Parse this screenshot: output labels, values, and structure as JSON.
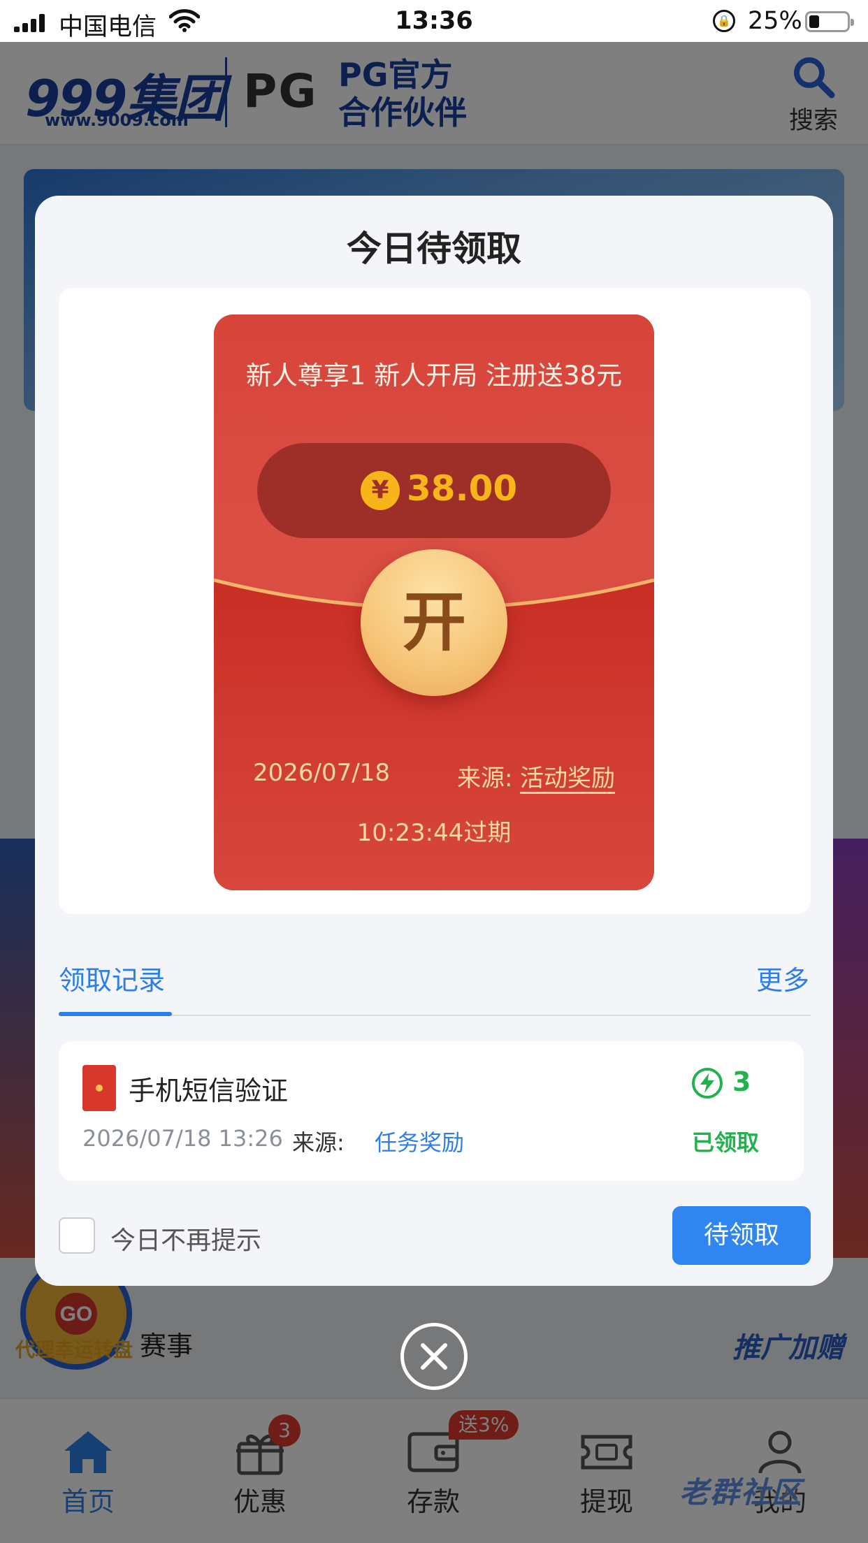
{
  "status_bar": {
    "carrier": "中国电信",
    "time": "13:36",
    "battery": "25%"
  },
  "header": {
    "brand": "999集团",
    "brand_url": "www.9009.com",
    "partner_logo": "PG",
    "partner_text": "PG官方 合作伙伴",
    "search_label": "搜索"
  },
  "background": {
    "section_title": "赛事",
    "wheel_label": "代理幸运转盘",
    "promo_label": "推广加赠"
  },
  "modal": {
    "title": "今日待领取",
    "envelope": {
      "title": "新人尊享1 新人开局 注册送38元",
      "currency_symbol": "¥",
      "amount": "38.00",
      "open_label": "开",
      "date": "2026/07/18",
      "source_label": "来源:",
      "source_value": "活动奖励",
      "expiry": "10:23:44过期"
    },
    "records": {
      "tab_label": "领取记录",
      "more_label": "更多",
      "items": [
        {
          "name": "手机短信验证",
          "count": "3",
          "datetime": "2026/07/18 13:26",
          "source_label": "来源:",
          "source_value": "任务奖励",
          "status": "已领取"
        }
      ]
    },
    "mute_label": "今日不再提示",
    "pending_button": "待领取"
  },
  "tabbar": {
    "items": [
      {
        "label": "首页",
        "icon": "home-icon",
        "active": true
      },
      {
        "label": "优惠",
        "icon": "gift-icon",
        "badge": "3"
      },
      {
        "label": "存款",
        "icon": "wallet-icon",
        "badge": "送3%"
      },
      {
        "label": "提现",
        "icon": "ticket-icon"
      },
      {
        "label": "我的",
        "icon": "user-icon"
      }
    ]
  },
  "watermark": "老群社区",
  "colors": {
    "accent": "#2d7ee8",
    "envelope_red": "#d7443a",
    "gold": "#f7b519",
    "success_green": "#22b14c"
  }
}
